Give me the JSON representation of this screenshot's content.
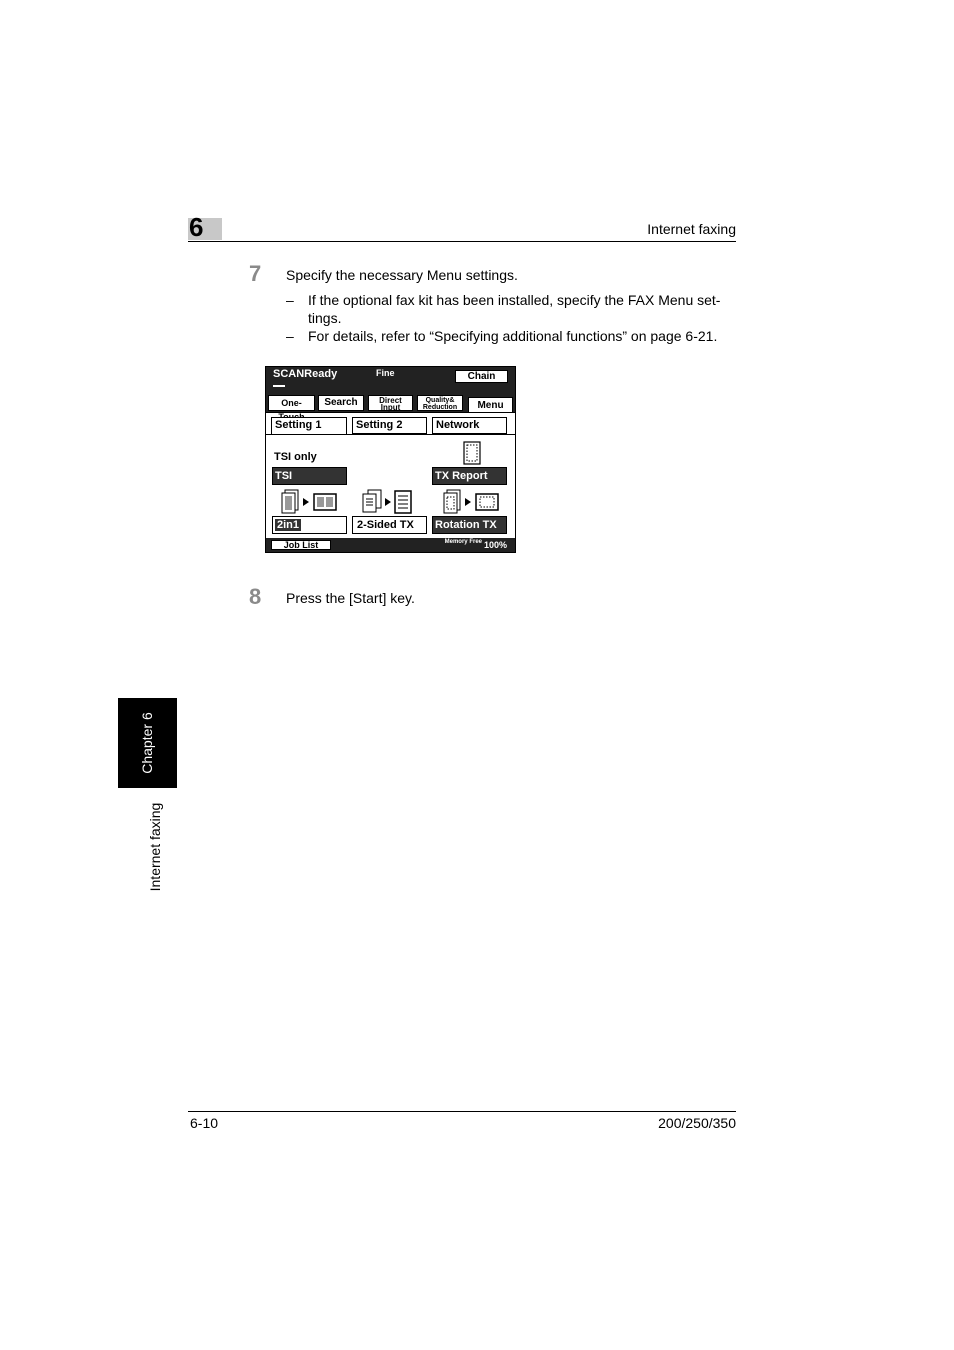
{
  "header": {
    "chapter_number": "6",
    "title": "Internet faxing"
  },
  "steps": [
    {
      "number": "7",
      "text": "Specify the necessary Menu settings.",
      "bullets": [
        {
          "mark": "–",
          "text": "If the optional fax kit has been installed, specify the FAX Menu set-"
        },
        {
          "mark": "",
          "text": "tings."
        },
        {
          "mark": "–",
          "text": "For details, refer to “Specifying additional functions” on page 6-21."
        }
      ]
    },
    {
      "number": "8",
      "text": "Press the [Start] key."
    }
  ],
  "screen": {
    "status": "SCANReady",
    "resolution": "Fine",
    "chain_button": "Chain",
    "top_tabs": [
      "One-Touch",
      "Search",
      "Direct Input",
      "Quality& Reduction",
      "Menu"
    ],
    "setting_tabs": [
      "Setting 1",
      "Setting 2",
      "Network"
    ],
    "tsi_label": "TSI only",
    "buttons": {
      "tsi": "TSI",
      "tx_report": "TX Report",
      "two_in_one": "2in1",
      "two_sided": "2-Sided TX",
      "rotation": "Rotation TX"
    },
    "job_list": "Job List",
    "memory_label": "Memory Free",
    "memory_value": "100%"
  },
  "side_tab": {
    "chapter": "Chapter 6",
    "title": "Internet faxing"
  },
  "footer": {
    "page": "6-10",
    "models": "200/250/350"
  }
}
